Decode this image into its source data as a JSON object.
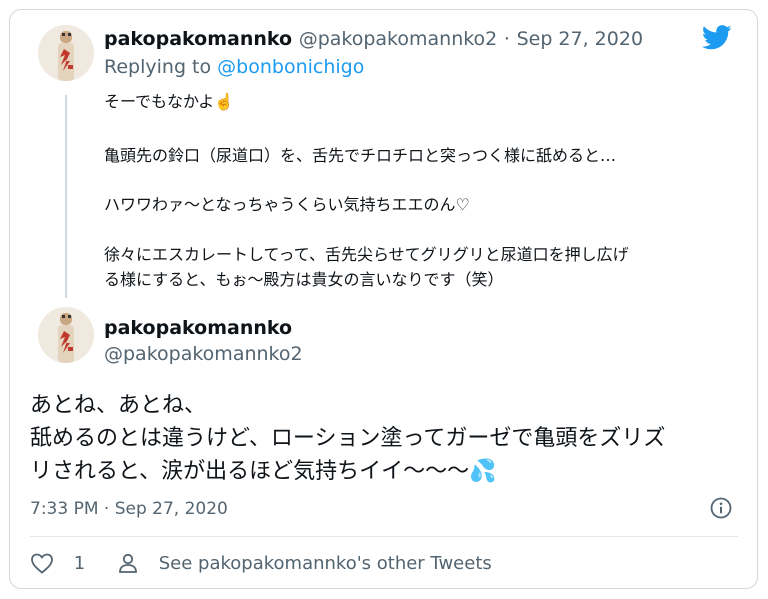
{
  "quoted_tweet": {
    "name": "pakopakomannko",
    "handle": "@pakopakomannko2",
    "separator": "·",
    "date": "Sep 27, 2020",
    "reply_prefix": "Replying to ",
    "reply_to": "@bonbonichigo",
    "lines": [
      "そーでもなかよ☝️",
      "亀頭先の鈴口（尿道口）を、舌先でチロチロと突っつく様に舐めると…",
      "ハワワわァ〜となっちゃうくらい気持ちエエのん♡",
      "徐々にエスカレートしてって、舌先尖らせてグリグリと尿道口を押し広げ",
      "る様にすると、もぉ〜殿方は貴女の言いなりです（笑）"
    ]
  },
  "main_tweet": {
    "name": "pakopakomannko",
    "handle": "@pakopakomannko2",
    "lines": [
      "あとね、あとね、",
      "舐めるのとは違うけど、ローション塗ってガーゼで亀頭をズリズ",
      "リされると、涙が出るほど気持ちイイ〜〜〜💦"
    ],
    "timestamp": "7:33 PM · Sep 27, 2020"
  },
  "actions": {
    "like_count": "1",
    "see_other": "See pakopakomannko's other Tweets"
  },
  "icons": {
    "brand": "twitter-bird-icon",
    "info": "info-icon",
    "like": "heart-icon",
    "profile": "person-icon"
  },
  "colors": {
    "brand_blue": "#1d9bf0",
    "secondary_text": "#536471",
    "border": "#cfd9de"
  }
}
